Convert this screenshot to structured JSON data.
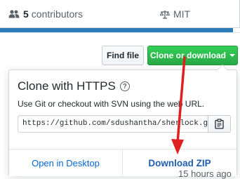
{
  "summary": {
    "contributors_count": "5",
    "contributors_label": "contributors",
    "license_label": "MIT"
  },
  "toolbar": {
    "find_file_label": "Find file",
    "clone_label": "Clone or download"
  },
  "clone_dropdown": {
    "title": "Clone with HTTPS",
    "help_glyph": "?",
    "description": "Use Git or checkout with SVN using the web URL.",
    "url_value": "https://github.com/sdushantha/sherlock.g",
    "copy_icon": "clipboard-icon",
    "open_desktop_label": "Open in Desktop",
    "download_zip_label": "Download ZIP"
  },
  "commit_time": "15 hours ago",
  "colors": {
    "clone_green": "#28a745",
    "link_blue": "#0366d6",
    "annotation_red": "#e02020",
    "top_bar_blue": "#2b7bb9"
  }
}
